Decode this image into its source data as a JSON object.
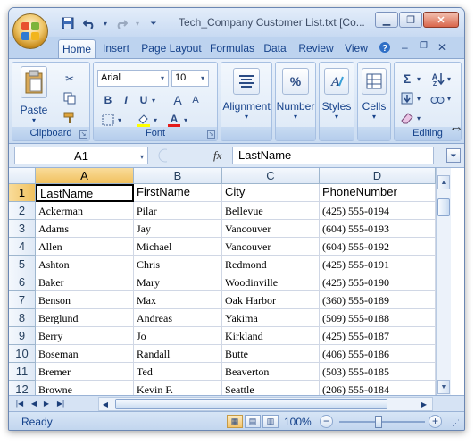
{
  "window": {
    "title": "Tech_Company Customer List.txt  [Co...",
    "minimize_icon": "minimize-icon",
    "restore_icon": "restore-icon",
    "close_icon": "close-icon"
  },
  "quick_access": {
    "save_icon": "save-icon",
    "undo_icon": "undo-icon",
    "redo_icon": "redo-icon",
    "customize_icon": "dropdown-icon"
  },
  "ribbon_tabs": [
    "Home",
    "Insert",
    "Page Layout",
    "Formulas",
    "Data",
    "Review",
    "View"
  ],
  "active_tab": "Home",
  "ribbon": {
    "clipboard": {
      "label": "Clipboard",
      "paste_label": "Paste"
    },
    "font": {
      "label": "Font",
      "font_name": "Arial",
      "font_size": "10",
      "bold": "B",
      "italic": "I",
      "underline": "U",
      "grow": "A",
      "shrink": "A"
    },
    "alignment": {
      "label": "Alignment"
    },
    "number": {
      "label": "Number",
      "symbol": "%"
    },
    "styles": {
      "label": "Styles"
    },
    "cells": {
      "label": "Cells"
    },
    "editing": {
      "label": "Editing",
      "sum_symbol": "Σ"
    }
  },
  "formula_bar": {
    "name_box": "A1",
    "fx": "fx",
    "content": "LastName"
  },
  "columns": [
    "A",
    "B",
    "C",
    "D"
  ],
  "selected_cell": "A1",
  "rows": [
    {
      "num": "1",
      "cells": [
        "LastName",
        "FirstName",
        "City",
        "PhoneNumber"
      ]
    },
    {
      "num": "2",
      "cells": [
        "Ackerman",
        "Pilar",
        "Bellevue",
        "(425) 555-0194"
      ]
    },
    {
      "num": "3",
      "cells": [
        "Adams",
        "Jay",
        "Vancouver",
        "(604) 555-0193"
      ]
    },
    {
      "num": "4",
      "cells": [
        "Allen",
        "Michael",
        "Vancouver",
        "(604) 555-0192"
      ]
    },
    {
      "num": "5",
      "cells": [
        "Ashton",
        "Chris",
        "Redmond",
        "(425) 555-0191"
      ]
    },
    {
      "num": "6",
      "cells": [
        "Baker",
        "Mary",
        "Woodinville",
        "(425) 555-0190"
      ]
    },
    {
      "num": "7",
      "cells": [
        "Benson",
        "Max",
        "Oak Harbor",
        "(360) 555-0189"
      ]
    },
    {
      "num": "8",
      "cells": [
        "Berglund",
        "Andreas",
        "Yakima",
        "(509) 555-0188"
      ]
    },
    {
      "num": "9",
      "cells": [
        "Berry",
        "Jo",
        "Kirkland",
        "(425) 555-0187"
      ]
    },
    {
      "num": "10",
      "cells": [
        "Boseman",
        "Randall",
        "Butte",
        "(406) 555-0186"
      ]
    },
    {
      "num": "11",
      "cells": [
        "Bremer",
        "Ted",
        "Beaverton",
        "(503) 555-0185"
      ]
    },
    {
      "num": "12",
      "cells": [
        "Browne",
        "Kevin F.",
        "Seattle",
        "(206) 555-0184"
      ]
    }
  ],
  "status": {
    "ready": "Ready",
    "zoom": "100%",
    "zoom_minus": "−",
    "zoom_plus": "+"
  },
  "colors": {
    "accent": "#15428b",
    "selection_header": "#f1c15f",
    "grid_line": "#d0d7e5"
  }
}
